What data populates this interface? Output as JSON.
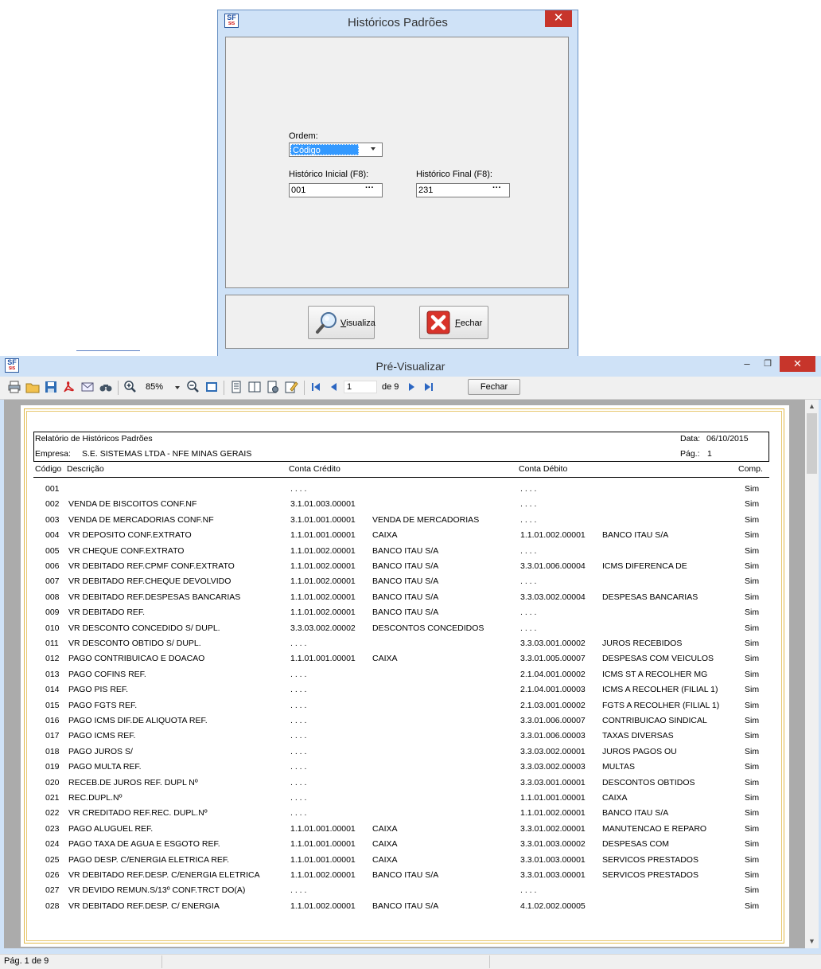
{
  "dialog": {
    "title": "Históricos Padrões",
    "close_glyph": "✕",
    "ordem_label": "Ordem:",
    "ordem_value": "Código",
    "inicial_label": "Histórico Inicial (F8):",
    "inicial_value": "001",
    "final_label": "Histórico Final (F8):",
    "final_value": "231",
    "ellipsis": "···",
    "visualiza_rest": "isualiza",
    "visualiza_key": "V",
    "fechar_key": "F",
    "fechar_rest": "echar"
  },
  "preview": {
    "title": "Pré-Visualizar",
    "minimize_glyph": "–",
    "restore_glyph": "❐",
    "close_glyph": "✕",
    "zoom": "85%",
    "page_input": "1",
    "page_of": "de 9",
    "close_button": "Fechar",
    "status": "Pág. 1 de 9"
  },
  "report": {
    "title": "Relatório de Históricos Padrões",
    "date_label": "Data:",
    "date_value": "06/10/2015",
    "empresa_label": "Empresa:",
    "empresa_value": "S.E. SISTEMAS LTDA - NFE MINAS GERAIS",
    "page_label": "Pág.:",
    "page_value": "1",
    "columns": {
      "codigo": "Código",
      "descricao": "Descrição",
      "credito": "Conta Crédito",
      "debito": "Conta Débito",
      "comp": "Comp."
    },
    "rows": [
      {
        "cod": "001",
        "desc": "",
        "cc": ". . . .",
        "ccn": "",
        "cd": ". . . .",
        "cdn": "",
        "comp": "Sim"
      },
      {
        "cod": "002",
        "desc": "VENDA DE BISCOITOS CONF.NF",
        "cc": "3.1.01.003.00001",
        "ccn": "",
        "cd": ". . . .",
        "cdn": "",
        "comp": "Sim"
      },
      {
        "cod": "003",
        "desc": "VENDA DE MERCADORIAS CONF.NF",
        "cc": "3.1.01.001.00001",
        "ccn": "VENDA DE MERCADORIAS",
        "cd": ". . . .",
        "cdn": "",
        "comp": "Sim"
      },
      {
        "cod": "004",
        "desc": "VR DEPOSITO CONF.EXTRATO",
        "cc": "1.1.01.001.00001",
        "ccn": "CAIXA",
        "cd": "1.1.01.002.00001",
        "cdn": "BANCO ITAU S/A",
        "comp": "Sim"
      },
      {
        "cod": "005",
        "desc": "VR CHEQUE CONF.EXTRATO",
        "cc": "1.1.01.002.00001",
        "ccn": "BANCO ITAU S/A",
        "cd": ". . . .",
        "cdn": "",
        "comp": "Sim"
      },
      {
        "cod": "006",
        "desc": "VR DEBITADO REF.CPMF CONF.EXTRATO",
        "cc": "1.1.01.002.00001",
        "ccn": "BANCO ITAU S/A",
        "cd": "3.3.01.006.00004",
        "cdn": "ICMS DIFERENCA DE",
        "comp": "Sim"
      },
      {
        "cod": "007",
        "desc": "VR DEBITADO REF.CHEQUE DEVOLVIDO",
        "cc": "1.1.01.002.00001",
        "ccn": "BANCO ITAU S/A",
        "cd": ". . . .",
        "cdn": "",
        "comp": "Sim"
      },
      {
        "cod": "008",
        "desc": "VR DEBITADO REF.DESPESAS BANCARIAS",
        "cc": "1.1.01.002.00001",
        "ccn": "BANCO ITAU S/A",
        "cd": "3.3.03.002.00004",
        "cdn": "DESPESAS BANCARIAS",
        "comp": "Sim"
      },
      {
        "cod": "009",
        "desc": "VR DEBITADO REF.",
        "cc": "1.1.01.002.00001",
        "ccn": "BANCO ITAU S/A",
        "cd": ". . . .",
        "cdn": "",
        "comp": "Sim"
      },
      {
        "cod": "010",
        "desc": "VR DESCONTO CONCEDIDO S/ DUPL.",
        "cc": "3.3.03.002.00002",
        "ccn": "DESCONTOS CONCEDIDOS",
        "cd": ". . . .",
        "cdn": "",
        "comp": "Sim"
      },
      {
        "cod": "011",
        "desc": "VR DESCONTO OBTIDO S/ DUPL.",
        "cc": ". . . .",
        "ccn": "",
        "cd": "3.3.03.001.00002",
        "cdn": "JUROS RECEBIDOS",
        "comp": "Sim"
      },
      {
        "cod": "012",
        "desc": "PAGO CONTRIBUICAO E DOACAO",
        "cc": "1.1.01.001.00001",
        "ccn": "CAIXA",
        "cd": "3.3.01.005.00007",
        "cdn": "DESPESAS COM VEICULOS",
        "comp": "Sim"
      },
      {
        "cod": "013",
        "desc": "PAGO COFINS REF.",
        "cc": ". . . .",
        "ccn": "",
        "cd": "2.1.04.001.00002",
        "cdn": "ICMS ST A RECOLHER MG",
        "comp": "Sim"
      },
      {
        "cod": "014",
        "desc": "PAGO PIS REF.",
        "cc": ". . . .",
        "ccn": "",
        "cd": "2.1.04.001.00003",
        "cdn": "ICMS A RECOLHER (FILIAL 1)",
        "comp": "Sim"
      },
      {
        "cod": "015",
        "desc": "PAGO FGTS REF.",
        "cc": ". . . .",
        "ccn": "",
        "cd": "2.1.03.001.00002",
        "cdn": "FGTS A RECOLHER (FILIAL 1)",
        "comp": "Sim"
      },
      {
        "cod": "016",
        "desc": "PAGO ICMS DIF.DE ALIQUOTA REF.",
        "cc": ". . . .",
        "ccn": "",
        "cd": "3.3.01.006.00007",
        "cdn": "CONTRIBUICAO SINDICAL",
        "comp": "Sim"
      },
      {
        "cod": "017",
        "desc": "PAGO ICMS REF.",
        "cc": ". . . .",
        "ccn": "",
        "cd": "3.3.01.006.00003",
        "cdn": "TAXAS DIVERSAS",
        "comp": "Sim"
      },
      {
        "cod": "018",
        "desc": "PAGO JUROS S/",
        "cc": ". . . .",
        "ccn": "",
        "cd": "3.3.03.002.00001",
        "cdn": "JUROS PAGOS OU",
        "comp": "Sim"
      },
      {
        "cod": "019",
        "desc": "PAGO MULTA REF.",
        "cc": ". . . .",
        "ccn": "",
        "cd": "3.3.03.002.00003",
        "cdn": "MULTAS",
        "comp": "Sim"
      },
      {
        "cod": "020",
        "desc": "RECEB.DE JUROS REF. DUPL Nº",
        "cc": ". . . .",
        "ccn": "",
        "cd": "3.3.03.001.00001",
        "cdn": "DESCONTOS OBTIDOS",
        "comp": "Sim"
      },
      {
        "cod": "021",
        "desc": "REC.DUPL.Nº",
        "cc": ". . . .",
        "ccn": "",
        "cd": "1.1.01.001.00001",
        "cdn": "CAIXA",
        "comp": "Sim"
      },
      {
        "cod": "022",
        "desc": "VR CREDITADO REF.REC. DUPL.Nº",
        "cc": ". . . .",
        "ccn": "",
        "cd": "1.1.01.002.00001",
        "cdn": "BANCO ITAU S/A",
        "comp": "Sim"
      },
      {
        "cod": "023",
        "desc": "PAGO ALUGUEL REF.",
        "cc": "1.1.01.001.00001",
        "ccn": "CAIXA",
        "cd": "3.3.01.002.00001",
        "cdn": "MANUTENCAO E REPARO",
        "comp": "Sim"
      },
      {
        "cod": "024",
        "desc": "PAGO TAXA DE AGUA E ESGOTO REF.",
        "cc": "1.1.01.001.00001",
        "ccn": "CAIXA",
        "cd": "3.3.01.003.00002",
        "cdn": "DESPESAS COM",
        "comp": "Sim"
      },
      {
        "cod": "025",
        "desc": "PAGO DESP. C/ENERGIA ELETRICA REF.",
        "cc": "1.1.01.001.00001",
        "ccn": "CAIXA",
        "cd": "3.3.01.003.00001",
        "cdn": "SERVICOS PRESTADOS",
        "comp": "Sim"
      },
      {
        "cod": "026",
        "desc": "VR DEBITADO REF.DESP. C/ENERGIA ELETRICA",
        "cc": "1.1.01.002.00001",
        "ccn": "BANCO ITAU S/A",
        "cd": "3.3.01.003.00001",
        "cdn": "SERVICOS PRESTADOS",
        "comp": "Sim"
      },
      {
        "cod": "027",
        "desc": "VR DEVIDO REMUN.S/13º CONF.TRCT DO(A)",
        "cc": ". . . .",
        "ccn": "",
        "cd": ". . . .",
        "cdn": "",
        "comp": "Sim"
      },
      {
        "cod": "028",
        "desc": "VR DEBITADO REF.DESP. C/ ENERGIA",
        "cc": "1.1.01.002.00001",
        "ccn": "BANCO ITAU S/A",
        "cd": "4.1.02.002.00005",
        "cdn": "",
        "comp": "Sim"
      }
    ]
  },
  "icons": {
    "app": "SF-app-icon",
    "toolbar": [
      "print-icon",
      "open-icon",
      "save-icon",
      "pdf-icon",
      "email-icon",
      "find-icon",
      "zoom-in-icon",
      "zoom-out-icon",
      "fit-page-icon",
      "single-page-icon",
      "multi-page-icon",
      "settings-icon",
      "edit-icon",
      "first-page-icon",
      "prev-page-icon",
      "next-page-icon",
      "last-page-icon"
    ]
  },
  "colors": {
    "titlebar": "#cfe2f7",
    "close": "#c7352b",
    "highlight": "#3399ff",
    "page_border": "#e0b84a"
  }
}
